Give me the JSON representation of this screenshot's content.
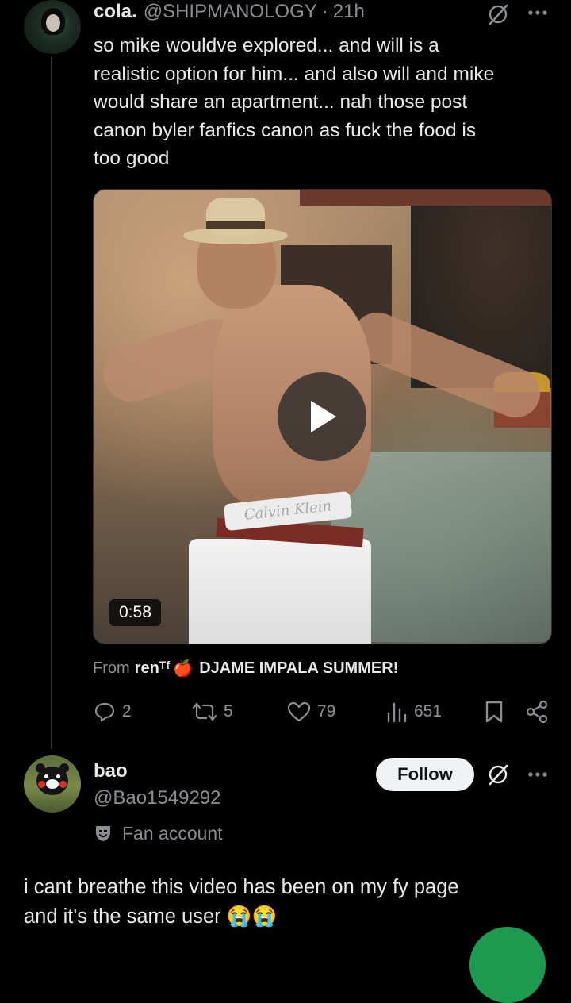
{
  "post": {
    "display_name": "cola.",
    "handle": "@SHIPMANOLOGY",
    "separator": "·",
    "time": "21h",
    "text_lines": [
      "so mike wouldve explored... and will is a",
      "realistic option for him... and also will and mike",
      "would share an apartment... nah those post",
      "canon byler fanfics canon as fuck the food is",
      "too good"
    ],
    "video": {
      "duration": "0:58",
      "waistband_text": "Calvin Klein"
    },
    "source": {
      "from_label": "From",
      "user": "renᵀᶠ",
      "emoji": "🍎",
      "title": "DJAME IMPALA SUMMER!"
    },
    "actions": {
      "replies": "2",
      "reposts": "5",
      "likes": "79",
      "views": "651"
    }
  },
  "reply": {
    "display_name": "bao",
    "handle": "@Bao1549292",
    "badge_label": "Fan account",
    "follow_label": "Follow",
    "text_lines": [
      "i cant breathe this video has been on my fy page",
      "and it's the same user 😭😭"
    ]
  },
  "icons": {
    "grok": "grok-icon",
    "more": "more-icon",
    "reply": "reply-icon",
    "repost": "repost-icon",
    "like": "heart-icon",
    "views": "views-icon",
    "bookmark": "bookmark-icon",
    "share": "share-icon",
    "play": "play-icon",
    "fan": "fan-account-icon"
  },
  "colors": {
    "background": "#000000",
    "text": "#e7e9ea",
    "secondary_text": "#8b8f94",
    "follow_button": "#eff3f4",
    "fab": "#1d9a4f"
  }
}
